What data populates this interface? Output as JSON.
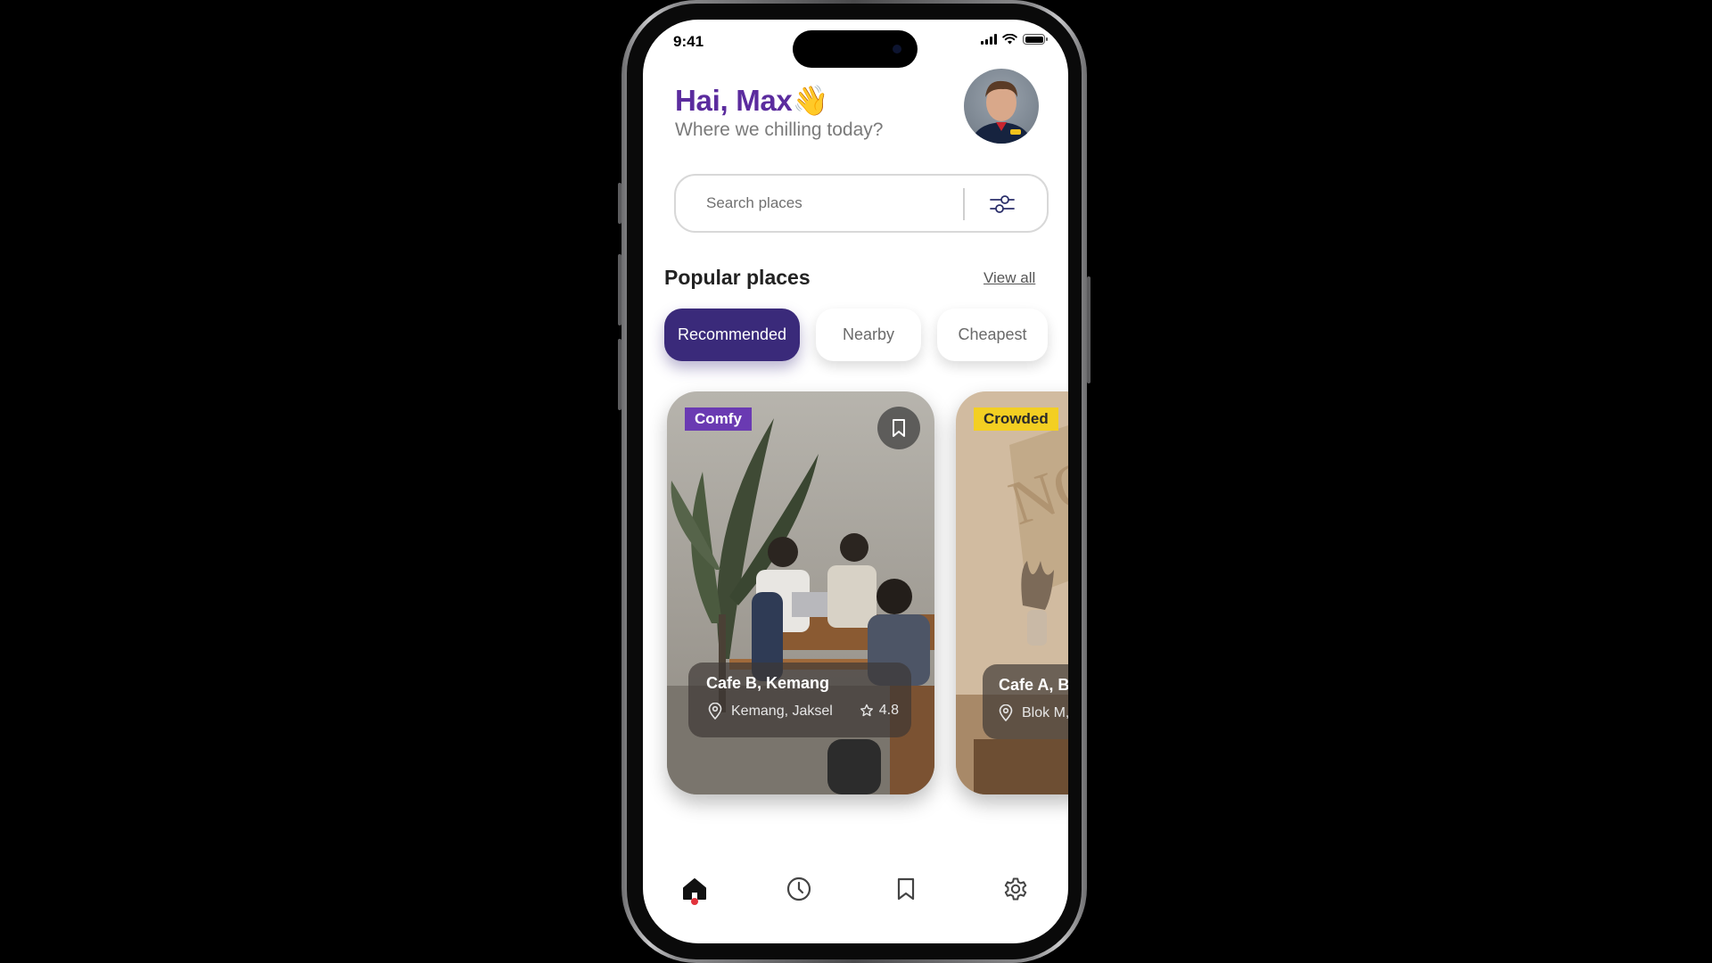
{
  "status_bar": {
    "time": "9:41"
  },
  "header": {
    "greeting": "Hai, Max👋",
    "subtitle": "Where we chilling today?"
  },
  "search": {
    "placeholder": "Search places"
  },
  "section": {
    "title": "Popular places",
    "view_all": "View all"
  },
  "filters": [
    {
      "label": "Recommended",
      "active": true
    },
    {
      "label": "Nearby",
      "active": false
    },
    {
      "label": "Cheapest",
      "active": false
    }
  ],
  "places": [
    {
      "tag": "Comfy",
      "tag_color": "#6a3ab2",
      "name": "Cafe B, Kemang",
      "location": "Kemang, Jaksel",
      "rating": "4.8",
      "bookmark_icon": "bookmark-icon"
    },
    {
      "tag": "Crowded",
      "tag_color": "#f3cf22",
      "name": "Cafe A, Blok M",
      "location": "Blok M, Jaksel"
    }
  ],
  "nav": [
    {
      "icon": "home-icon",
      "active": true
    },
    {
      "icon": "clock-icon",
      "active": false
    },
    {
      "icon": "bookmark-icon",
      "active": false
    },
    {
      "icon": "gear-icon",
      "active": false
    }
  ],
  "colors": {
    "accent": "#5b2c9e",
    "active_chip": "#3a2a7a",
    "nav_dot": "#e2333c"
  }
}
